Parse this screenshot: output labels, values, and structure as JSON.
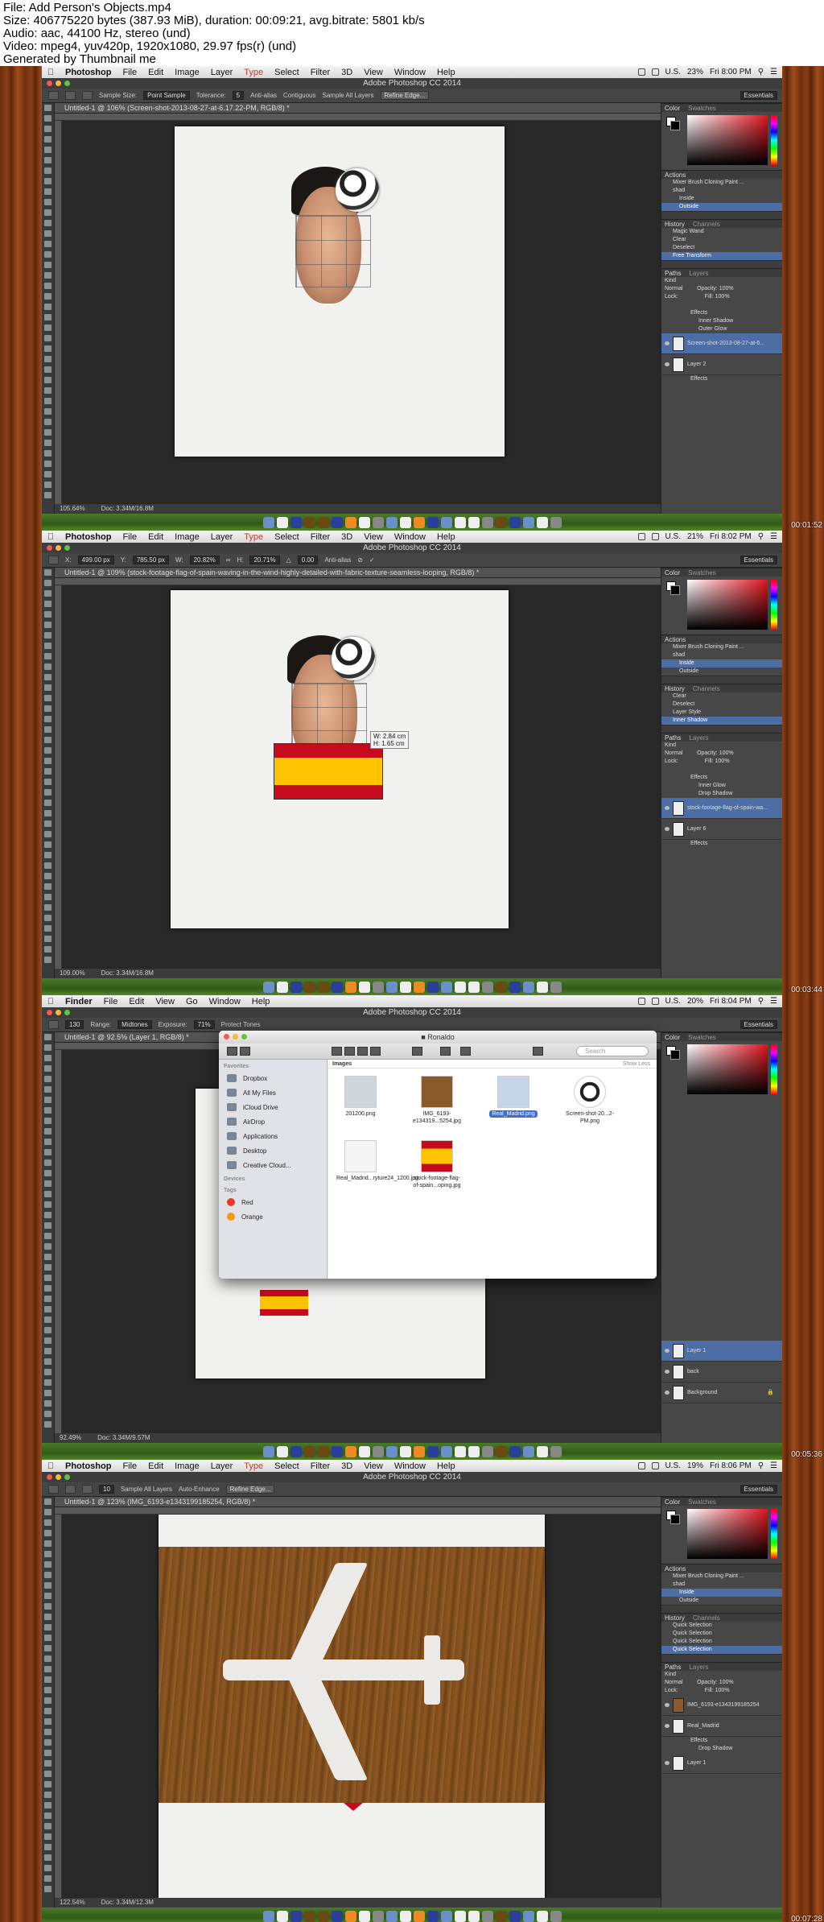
{
  "meta": {
    "line1": "File: Add Person's Objects.mp4",
    "line2": "Size: 406775220 bytes (387.93 MiB), duration: 00:09:21, avg.bitrate: 5801 kb/s",
    "line3": "Audio: aac, 44100 Hz, stereo (und)",
    "line4": "Video: mpeg4, yuv420p, 1920x1080, 29.97 fps(r) (und)",
    "line5": "Generated by Thumbnail me"
  },
  "menu": {
    "apple": "",
    "ps": [
      "Photoshop",
      "File",
      "Edit",
      "Image",
      "Layer",
      "Type",
      "Select",
      "Filter",
      "3D",
      "View",
      "Window",
      "Help"
    ],
    "finder": [
      "Finder",
      "File",
      "Edit",
      "View",
      "Go",
      "Window",
      "Help"
    ],
    "country": "U.S."
  },
  "frames": [
    {
      "stamp": "00:01:52",
      "window_title": "Adobe Photoshop CC 2014",
      "battery": "23%",
      "clock": "Fri 8:00 PM",
      "options": {
        "sample_size_label": "Sample Size:",
        "sample_size": "Point Sample",
        "tolerance_label": "Tolerance:",
        "tolerance": "5",
        "c1": "Anti-alias",
        "c2": "Contiguous",
        "c3": "Sample All Layers",
        "refine": "Refine Edge..."
      },
      "workspace": "Essentials",
      "doc_tab": "Untitled-1 @ 106% (Screen-shot-2013-08-27-at-6.17.22-PM, RGB/8) *",
      "zoom": "105.64%",
      "doc": "Doc: 3.34M/16.8M",
      "color_tabs": [
        "Color",
        "Swatches"
      ],
      "actions_tab": "Actions",
      "actions": [
        "Mixer Brush Cloning Paint ...",
        "shad",
        "Inside",
        "Outside"
      ],
      "actions_selected": 3,
      "history_tabs": [
        "History",
        "Channels"
      ],
      "history": [
        "Magic Wand",
        "Clear",
        "Deselect",
        "Free Transform"
      ],
      "history_selected": 3,
      "layers_tabs": [
        "Paths",
        "Layers"
      ],
      "kind": "Kind",
      "blend": "Normal",
      "opacity_label": "Opacity:",
      "opacity": "100%",
      "lock_label": "Lock:",
      "fill_label": "Fill:",
      "fill": "100%",
      "layers": [
        {
          "name": "",
          "sub": false
        },
        {
          "name": "Effects",
          "sub": true
        },
        {
          "name": "Inner Shadow",
          "sub": true
        },
        {
          "name": "Outer Glow",
          "sub": true
        },
        {
          "name": "Screen-shot-2013-08-27-at-6...",
          "sel": true
        },
        {
          "name": "Layer 2",
          "fx": true
        },
        {
          "name": "Effects",
          "sub": true
        }
      ]
    },
    {
      "stamp": "00:03:44",
      "window_title": "Adobe Photoshop CC 2014",
      "battery": "21%",
      "clock": "Fri 8:02 PM",
      "options": {
        "x_label": "X:",
        "x": "499.00 px",
        "y_label": "Y:",
        "y": "785.50 px",
        "w_label": "W:",
        "w": "20.82%",
        "h_label": "H:",
        "h": "20.71%",
        "angle": "0.00",
        "aa": "Anti-alias"
      },
      "workspace": "Essentials",
      "doc_tab": "Untitled-1 @ 109% (stock-footage-flag-of-spain-waving-in-the-wind-highly-detailed-with-fabric-texture-seamless-looping, RGB/8) *",
      "zoom": "109.00%",
      "doc": "Doc: 3.34M/16.8M",
      "tooltip": {
        "w": "W: 2.84 cm",
        "h": "H: 1.65 cm"
      },
      "actions": [
        "Mixer Brush Cloning Paint ...",
        "shad",
        "Inside",
        "Outside"
      ],
      "actions_selected": 2,
      "history": [
        "Clear",
        "Deselect",
        "Layer Style",
        "Inner Shadow"
      ],
      "history_selected": 3,
      "layers": [
        {
          "name": "",
          "sub": false
        },
        {
          "name": "Effects",
          "sub": true
        },
        {
          "name": "Inner Glow",
          "sub": true
        },
        {
          "name": "Drop Shadow",
          "sub": true
        },
        {
          "name": "stock-footage-flag-of-spain-wa...",
          "sel": true
        },
        {
          "name": "Layer 6",
          "fx": true
        },
        {
          "name": "Effects",
          "sub": true
        }
      ]
    },
    {
      "stamp": "00:05:36",
      "window_title": "Adobe Photoshop CC 2014",
      "battery": "20%",
      "clock": "Fri 8:04 PM",
      "options": {
        "brush": "130",
        "range_label": "Range:",
        "range": "Midtones",
        "exposure_label": "Exposure:",
        "exposure": "71%",
        "protect": "Protect Tones"
      },
      "workspace": "Essentials",
      "doc_tab": "Untitled-1 @ 92.5% (Layer 1, RGB/8) *",
      "zoom": "92.49%",
      "doc": "Doc: 3.34M/9.57M",
      "finder": {
        "title": "Ronaldo",
        "search": "Search",
        "group": "Images",
        "show_less": "Show Less",
        "favorites": "Favorites",
        "devices": "Devices",
        "tags": "Tags",
        "sidebar": [
          "Dropbox",
          "All My Files",
          "iCloud Drive",
          "AirDrop",
          "Applications",
          "Desktop",
          "Creative Cloud..."
        ],
        "tag_items": [
          "Red",
          "Orange"
        ],
        "files": [
          {
            "name": "201200.png"
          },
          {
            "name": "IMG_6193-e134319...5254.jpg"
          },
          {
            "name": "Real_Madrid.png",
            "sel": true
          },
          {
            "name": "Screen-shot-20...2-PM.png"
          },
          {
            "name": "Real_Madrid...ryture24_1200.jpg"
          },
          {
            "name": "stock-footage-flag-of-spain...oping.jpg"
          }
        ]
      },
      "layers": [
        {
          "name": "Layer 1",
          "sel": true
        },
        {
          "name": "back"
        },
        {
          "name": "Background",
          "lock": true
        }
      ]
    },
    {
      "stamp": "00:07:28",
      "window_title": "Adobe Photoshop CC 2014",
      "battery": "19%",
      "clock": "Fri 8:06 PM",
      "options": {
        "brush": "10",
        "c1": "Sample All Layers",
        "c2": "Auto-Enhance",
        "refine": "Refine Edge..."
      },
      "workspace": "Essentials",
      "doc_tab": "Untitled-1 @ 123% (IMG_6193-e1343199185254, RGB/8) *",
      "zoom": "122.54%",
      "doc": "Doc: 3.34M/12.3M",
      "actions": [
        "Mixer Brush Cloning Paint ...",
        "shad",
        "Inside",
        "Outside"
      ],
      "actions_selected": 2,
      "history": [
        "Quick Selection",
        "Quick Selection",
        "Quick Selection",
        "Quick Selection"
      ],
      "history_selected": 3,
      "layers": [
        {
          "name": "IMG_6193-e1343199185254",
          "sel": false
        },
        {
          "name": "Real_Madrid",
          "fx": false
        },
        {
          "name": "Effects",
          "sub": true
        },
        {
          "name": "Drop Shadow",
          "sub": true
        },
        {
          "name": "Layer 1"
        }
      ]
    }
  ]
}
